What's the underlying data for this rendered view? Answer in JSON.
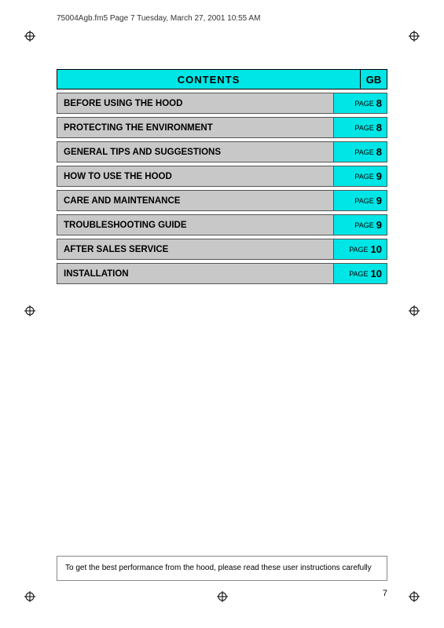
{
  "header": {
    "file_info": "75004Agb.fm5  Page 7  Tuesday, March 27, 2001  10:55 AM"
  },
  "contents": {
    "title": "CONTENTS",
    "gb_label": "GB",
    "rows": [
      {
        "label": "BEFORE USING THE HOOD",
        "page_word": "PAGE",
        "page_num": "8"
      },
      {
        "label": "PROTECTING THE ENVIRONMENT",
        "page_word": "PAGE",
        "page_num": "8"
      },
      {
        "label": "GENERAL TIPS AND SUGGESTIONS",
        "page_word": "PAGE",
        "page_num": "8"
      },
      {
        "label": "HOW TO USE THE HOOD",
        "page_word": "PAGE",
        "page_num": "9"
      },
      {
        "label": "CARE AND MAINTENANCE",
        "page_word": "PAGE",
        "page_num": "9"
      },
      {
        "label": "TROUBLESHOOTING GUIDE",
        "page_word": "PAGE",
        "page_num": "9"
      },
      {
        "label": "AFTER SALES SERVICE",
        "page_word": "PAGE",
        "page_num": "10"
      },
      {
        "label": "INSTALLATION",
        "page_word": "PAGE",
        "page_num": "10"
      }
    ]
  },
  "bottom_note": {
    "text": "To get the best performance from the hood, please read these user instructions carefully"
  },
  "page_number": "7"
}
